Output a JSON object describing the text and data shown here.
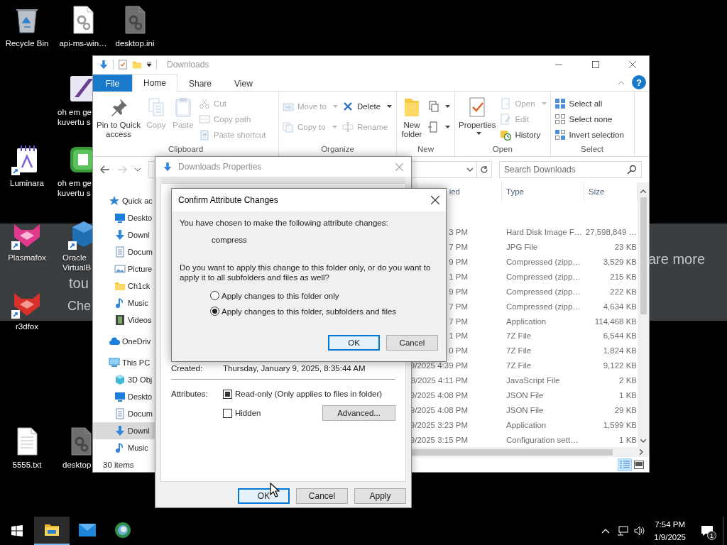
{
  "desktop": {
    "banner": {
      "texts": [
        "tou",
        "Che",
        "are more"
      ]
    },
    "icons": [
      {
        "label": "Recycle Bin",
        "shortcut": false
      },
      {
        "label": "api-ms-win…",
        "shortcut": false
      },
      {
        "label": "desktop.ini",
        "shortcut": false
      },
      {
        "label": "oh em ge\nkuvertu s",
        "shortcut": false
      },
      {
        "label": "Luminara",
        "shortcut": true
      },
      {
        "label": "oh em ge\nkuvertu s",
        "shortcut": false
      },
      {
        "label": "Plasmafox",
        "shortcut": true
      },
      {
        "label": "Oracle\nVirtualB",
        "shortcut": true
      },
      {
        "label": "r3dfox",
        "shortcut": true
      },
      {
        "label": "5555.txt",
        "shortcut": false
      },
      {
        "label": "desktop",
        "shortcut": false
      }
    ]
  },
  "explorer": {
    "title": "Downloads",
    "tabs": [
      {
        "label": "File",
        "kind": "menu",
        "selected": false
      },
      {
        "label": "Home",
        "kind": "tab",
        "selected": true
      },
      {
        "label": "Share",
        "kind": "tab",
        "selected": false
      },
      {
        "label": "View",
        "kind": "tab",
        "selected": false
      }
    ],
    "help": "?",
    "ribbon": {
      "groups": [
        {
          "label": "Clipboard",
          "items": [
            {
              "kind": "large",
              "label": "Pin to Quick\naccess",
              "disabled": false,
              "dropdown": false
            },
            {
              "kind": "large",
              "label": "Copy",
              "disabled": true,
              "dropdown": false
            },
            {
              "kind": "large",
              "label": "Paste",
              "disabled": true,
              "dropdown": false
            },
            {
              "kind": "stack",
              "items": [
                {
                  "label": "Cut",
                  "disabled": true,
                  "dropdown": false
                },
                {
                  "label": "Copy path",
                  "disabled": true,
                  "dropdown": false
                },
                {
                  "label": "Paste shortcut",
                  "disabled": true,
                  "dropdown": false
                }
              ]
            }
          ]
        },
        {
          "label": "Organize",
          "items": [
            {
              "kind": "stack",
              "items": [
                {
                  "label": "Move to",
                  "disabled": true,
                  "dropdown": true
                },
                {
                  "label": "Copy to",
                  "disabled": true,
                  "dropdown": true
                }
              ]
            },
            {
              "kind": "stack",
              "items": [
                {
                  "label": "Delete",
                  "disabled": false,
                  "dropdown": true
                },
                {
                  "label": "Rename",
                  "disabled": true,
                  "dropdown": false
                }
              ]
            }
          ]
        },
        {
          "label": "New",
          "items": [
            {
              "kind": "large",
              "label": "New\nfolder",
              "disabled": false,
              "dropdown": false
            },
            {
              "kind": "stack",
              "items": [
                {
                  "disabled": false,
                  "dropdown": true
                },
                {
                  "disabled": false,
                  "dropdown": true
                }
              ]
            }
          ]
        },
        {
          "label": "Open",
          "items": [
            {
              "kind": "large",
              "label": "Properties",
              "disabled": false,
              "dropdown": true
            },
            {
              "kind": "stack",
              "items": [
                {
                  "label": "Open",
                  "disabled": true,
                  "dropdown": true
                },
                {
                  "label": "Edit",
                  "disabled": true,
                  "dropdown": false
                },
                {
                  "label": "History",
                  "disabled": false,
                  "dropdown": false
                }
              ]
            }
          ]
        },
        {
          "label": "Select",
          "items": [
            {
              "kind": "stack",
              "items": [
                {
                  "label": "Select all",
                  "disabled": false,
                  "dropdown": false
                },
                {
                  "label": "Select none",
                  "disabled": false,
                  "dropdown": false
                },
                {
                  "label": "Invert selection",
                  "disabled": false,
                  "dropdown": false
                }
              ]
            }
          ]
        }
      ]
    },
    "search": {
      "placeholder": "Search Downloads"
    },
    "navigation": [
      {
        "label": "Quick ac",
        "selected": false,
        "children": [
          {
            "label": "Deskto",
            "selected": false
          },
          {
            "label": "Downl",
            "selected": false
          },
          {
            "label": "Docum",
            "selected": false
          },
          {
            "label": "Picture",
            "selected": false
          },
          {
            "label": "Ch1ck",
            "selected": false
          },
          {
            "label": "Music",
            "selected": false
          },
          {
            "label": "Videos",
            "selected": false
          }
        ]
      },
      {
        "label": "OneDriv",
        "selected": false
      },
      {
        "label": "This PC",
        "selected": false,
        "children": [
          {
            "label": "3D Obj",
            "selected": false
          },
          {
            "label": "Deskto",
            "selected": false
          },
          {
            "label": "Docum",
            "selected": false
          },
          {
            "label": "Downl",
            "selected": true
          },
          {
            "label": "Music",
            "selected": false
          }
        ]
      }
    ],
    "columns": [
      "ied",
      "Type",
      "Size"
    ],
    "rows": [
      {
        "date": "3 PM",
        "type": "Hard Disk Image F…",
        "size": "27,598,849 …"
      },
      {
        "date": "7 PM",
        "type": "JPG File",
        "size": "23 KB"
      },
      {
        "date": "9 PM",
        "type": "Compressed (zipp…",
        "size": "3,529 KB"
      },
      {
        "date": "1 PM",
        "type": "Compressed (zipp…",
        "size": "215 KB"
      },
      {
        "date": "9 PM",
        "type": "Compressed (zipp…",
        "size": "222 KB"
      },
      {
        "date": "7 PM",
        "type": "Compressed (zipp…",
        "size": "4,634 KB"
      },
      {
        "date": "7 PM",
        "type": "Application",
        "size": "114,468 KB"
      },
      {
        "date": "1 PM",
        "type": "7Z File",
        "size": "6,544 KB"
      },
      {
        "date": "0 PM",
        "type": "7Z File",
        "size": "1,824 KB"
      },
      {
        "date": "9/2025 4:39 PM",
        "type": "7Z File",
        "size": "9,122 KB"
      },
      {
        "date": "9/2025 4:11 PM",
        "type": "JavaScript File",
        "size": "2 KB"
      },
      {
        "date": "9/2025 4:08 PM",
        "type": "JSON File",
        "size": "1 KB"
      },
      {
        "date": "9/2025 4:08 PM",
        "type": "JSON File",
        "size": "29 KB"
      },
      {
        "date": "9/2025 3:23 PM",
        "type": "Application",
        "size": "1,599 KB"
      },
      {
        "date": "9/2025 3:15 PM",
        "type": "Configuration sett…",
        "size": "1 KB"
      }
    ],
    "status": "30 items",
    "views": [
      {
        "selected": true
      },
      {
        "selected": false
      }
    ]
  },
  "properties_dialog": {
    "title": "Downloads Properties",
    "created_label": "Created:",
    "created_value": "Thursday, January 9, 2025, 8:35:44 AM",
    "attributes_label": "Attributes:",
    "attributes": [
      {
        "label": "Read-only (Only applies to files in folder)",
        "checked": false,
        "indeterminate": true
      },
      {
        "label": "Hidden",
        "checked": false,
        "indeterminate": false
      }
    ],
    "advanced_button": "Advanced...",
    "buttons": [
      {
        "label": "OK",
        "default": true
      },
      {
        "label": "Cancel",
        "default": false
      },
      {
        "label": "Apply",
        "default": false
      }
    ]
  },
  "confirm_dialog": {
    "title": "Confirm Attribute Changes",
    "message": "You have chosen to make the following attribute changes:",
    "changes": [
      "compress"
    ],
    "question": "Do you want to apply this change to this folder only, or do you want to apply it to all subfolders and files as well?",
    "options": [
      {
        "label": "Apply changes to this folder only",
        "selected": false
      },
      {
        "label": "Apply changes to this folder, subfolders and files",
        "selected": true
      }
    ],
    "buttons": [
      {
        "label": "OK",
        "default": true
      },
      {
        "label": "Cancel",
        "default": false
      }
    ]
  },
  "taskbar": {
    "apps": [
      {
        "active": true
      },
      {
        "active": false
      },
      {
        "active": false
      }
    ],
    "time": "7:54 PM",
    "date": "1/9/2025",
    "notifications": "1"
  }
}
